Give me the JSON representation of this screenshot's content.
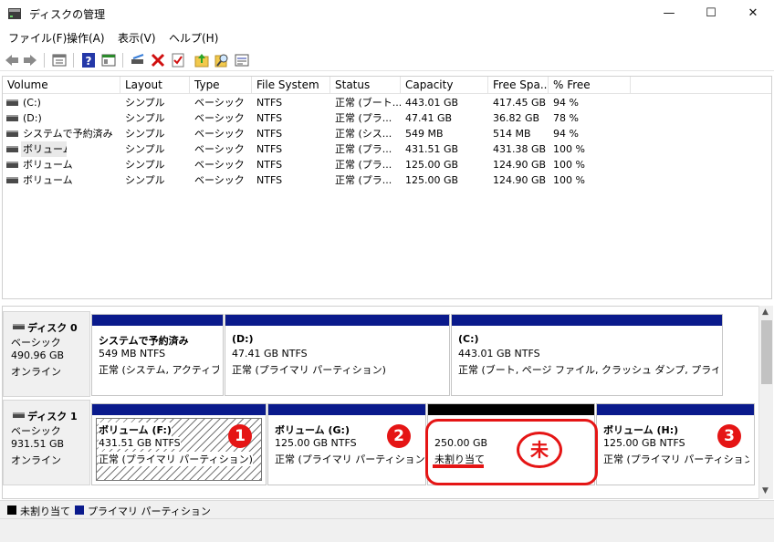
{
  "window": {
    "title": "ディスクの管理",
    "minimize": "—",
    "maximize": "☐",
    "close": "✕"
  },
  "menu": {
    "items": [
      "ファイル(F)",
      "操作(A)",
      "表示(V)",
      "ヘルプ(H)"
    ]
  },
  "toolbar": {
    "icons": [
      "back-icon",
      "forward-icon",
      "properties-icon",
      "help-icon",
      "show-hide-icon",
      "connect-icon",
      "delete-icon",
      "check-icon",
      "import-icon",
      "search-icon",
      "settings-icon"
    ]
  },
  "volume_list": {
    "columns": [
      "Volume",
      "Layout",
      "Type",
      "File System",
      "Status",
      "Capacity",
      "Free Spa...",
      "% Free"
    ],
    "rows": [
      {
        "volume": "(C:)",
        "layout": "シンプル",
        "type": "ベーシック",
        "fs": "NTFS",
        "status": "正常 (ブート...",
        "capacity": "443.01 GB",
        "free": "417.45 GB",
        "pct": "94 %"
      },
      {
        "volume": "(D:)",
        "layout": "シンプル",
        "type": "ベーシック",
        "fs": "NTFS",
        "status": "正常 (プラ...",
        "capacity": "47.41 GB",
        "free": "36.82 GB",
        "pct": "78 %"
      },
      {
        "volume": "システムで予約済み",
        "layout": "シンプル",
        "type": "ベーシック",
        "fs": "NTFS",
        "status": "正常 (シス...",
        "capacity": "549 MB",
        "free": "514 MB",
        "pct": "94 %"
      },
      {
        "volume": "ボリューム",
        "layout": "シンプル",
        "type": "ベーシック",
        "fs": "NTFS",
        "status": "正常 (プラ...",
        "capacity": "431.51 GB",
        "free": "431.38 GB",
        "pct": "100 %"
      },
      {
        "volume": "ボリューム",
        "layout": "シンプル",
        "type": "ベーシック",
        "fs": "NTFS",
        "status": "正常 (プラ...",
        "capacity": "125.00 GB",
        "free": "124.90 GB",
        "pct": "100 %"
      },
      {
        "volume": "ボリューム",
        "layout": "シンプル",
        "type": "ベーシック",
        "fs": "NTFS",
        "status": "正常 (プラ...",
        "capacity": "125.00 GB",
        "free": "124.90 GB",
        "pct": "100 %"
      }
    ]
  },
  "disks": [
    {
      "name": "ディスク 0",
      "type": "ベーシック",
      "size": "490.96 GB",
      "state": "オンライン",
      "partitions": [
        {
          "title": "システムで予約済み",
          "size": "549 MB NTFS",
          "status": "正常 (システム, アクティブ, プ"
        },
        {
          "title": "(D:)",
          "size": "47.41 GB NTFS",
          "status": "正常 (プライマリ パーティション)"
        },
        {
          "title": "(C:)",
          "size": "443.01 GB NTFS",
          "status": "正常 (ブート, ページ ファイル, クラッシュ ダンプ, プライマリ パーテ"
        }
      ]
    },
    {
      "name": "ディスク 1",
      "type": "ベーシック",
      "size": "931.51 GB",
      "state": "オンライン",
      "partitions": [
        {
          "title": "ボリューム (F:)",
          "size": "431.51 GB NTFS",
          "status": "正常 (プライマリ パーティション)"
        },
        {
          "title": "ボリューム (G:)",
          "size": "125.00 GB NTFS",
          "status": "正常 (プライマリ パーティション)"
        },
        {
          "title": "",
          "size": "250.00 GB",
          "status": "未割り当て"
        },
        {
          "title": "ボリューム (H:)",
          "size": "125.00 GB NTFS",
          "status": "正常 (プライマリ パーティション)"
        }
      ]
    }
  ],
  "annotations": {
    "badge1": "1",
    "badge2": "2",
    "badge3": "3",
    "unallocated_mark": "未"
  },
  "legend": {
    "unallocated": "未割り当て",
    "primary": "プライマリ パーティション"
  },
  "colors": {
    "primary_bar": "#0a1a8c",
    "unallocated_bar": "#000000",
    "annotation_red": "#e51515"
  }
}
